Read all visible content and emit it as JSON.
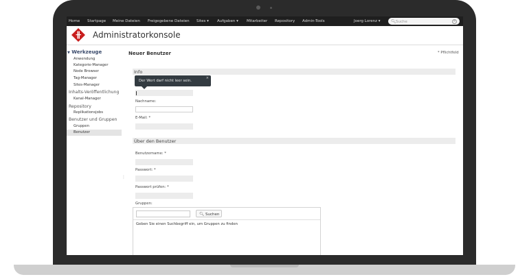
{
  "topnav": {
    "items": [
      "Home",
      "Startpage",
      "Meine Dateien",
      "Freigegebene Dateien",
      "Sites ▾",
      "Aufgaben ▾",
      "Mitarbeiter",
      "Repository",
      "Admin-Tools"
    ],
    "user": "Joerg Lorenz ▾",
    "search_placeholder": "Suche"
  },
  "header": {
    "title": "Administratorkonsole",
    "logo_icon": "alfresco-logo-icon",
    "accent": "#c81e1e"
  },
  "sidebar": {
    "heading": "Werkzeuge",
    "tools": [
      "Anwendung",
      "Kategorie-Manager",
      "Node Browser",
      "Tag-Manager",
      "Sites-Manager"
    ],
    "publishing_section": "Inhalts-Veröffentlichung",
    "publishing_items": [
      "Kanal-Manager"
    ],
    "repository_section": "Repository",
    "repository_items": [
      "Replikationsjobs"
    ],
    "users_section": "Benutzer und Gruppen",
    "users_items": [
      "Gruppen",
      "Benutzer"
    ],
    "active_item": "Benutzer"
  },
  "main": {
    "title": "Neuer Benutzer",
    "required_note": "* Pflichtfeld",
    "info_section": "Info",
    "tooltip": "Der Wert darf nicht leer sein.",
    "tooltip_close": "×",
    "lastname_label": "Nachname:",
    "email_label": "E-Mail: *",
    "about_section": "Über den Benutzer",
    "username_label": "Benutzername: *",
    "password_label": "Passwort: *",
    "password_confirm_label": "Passwort prüfen: *",
    "groups_label": "Gruppen:",
    "groups_search_button": "Suchen",
    "groups_hint": "Geben Sie einen Suchbegriff ein, um Gruppen zu finden"
  }
}
